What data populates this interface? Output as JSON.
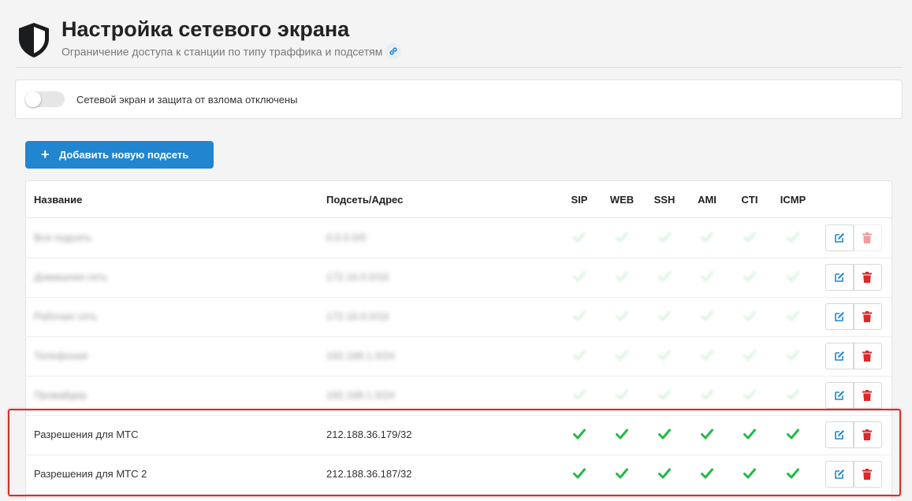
{
  "header": {
    "title": "Настройка сетевого экрана",
    "subtitle": "Ограничение доступа к станции по типу траффика и подсетям",
    "icon": "shield-icon",
    "link_icon": "link-icon"
  },
  "firewall_toggle": {
    "label": "Сетевой экран и защита от взлома отключены",
    "enabled": false
  },
  "toolbar": {
    "add_subnet_label": "Добавить новую подсеть",
    "add_icon": "plus-icon"
  },
  "table": {
    "columns": {
      "name": "Название",
      "subnet": "Подсеть/Адрес",
      "sip": "SIP",
      "web": "WEB",
      "ssh": "SSH",
      "ami": "AMI",
      "cti": "CTI",
      "icmp": "ICMP"
    },
    "rows": [
      {
        "name": "Вся подсеть",
        "subnet": "0.0.0.0/0",
        "blurred": true,
        "delete_enabled": false
      },
      {
        "name": "Домашняя сеть",
        "subnet": "172.16.0.0/16",
        "blurred": true,
        "delete_enabled": true
      },
      {
        "name": "Рабочая сеть",
        "subnet": "172.16.0.0/16",
        "blurred": true,
        "delete_enabled": true
      },
      {
        "name": "Телефония",
        "subnet": "192.168.1.0/24",
        "blurred": true,
        "delete_enabled": true
      },
      {
        "name": "Провайдер",
        "subnet": "192.168.1.0/24",
        "blurred": true,
        "delete_enabled": true
      },
      {
        "name": "Разрешения для МТС",
        "subnet": "212.188.36.179/32",
        "blurred": false,
        "delete_enabled": true
      },
      {
        "name": "Разрешения для МТС 2",
        "subnet": "212.188.36.187/32",
        "blurred": false,
        "delete_enabled": true
      }
    ]
  },
  "colors": {
    "accent": "#2185d0",
    "check": "#21ba45",
    "delete": "#db2828",
    "highlight": "#d0302e"
  }
}
